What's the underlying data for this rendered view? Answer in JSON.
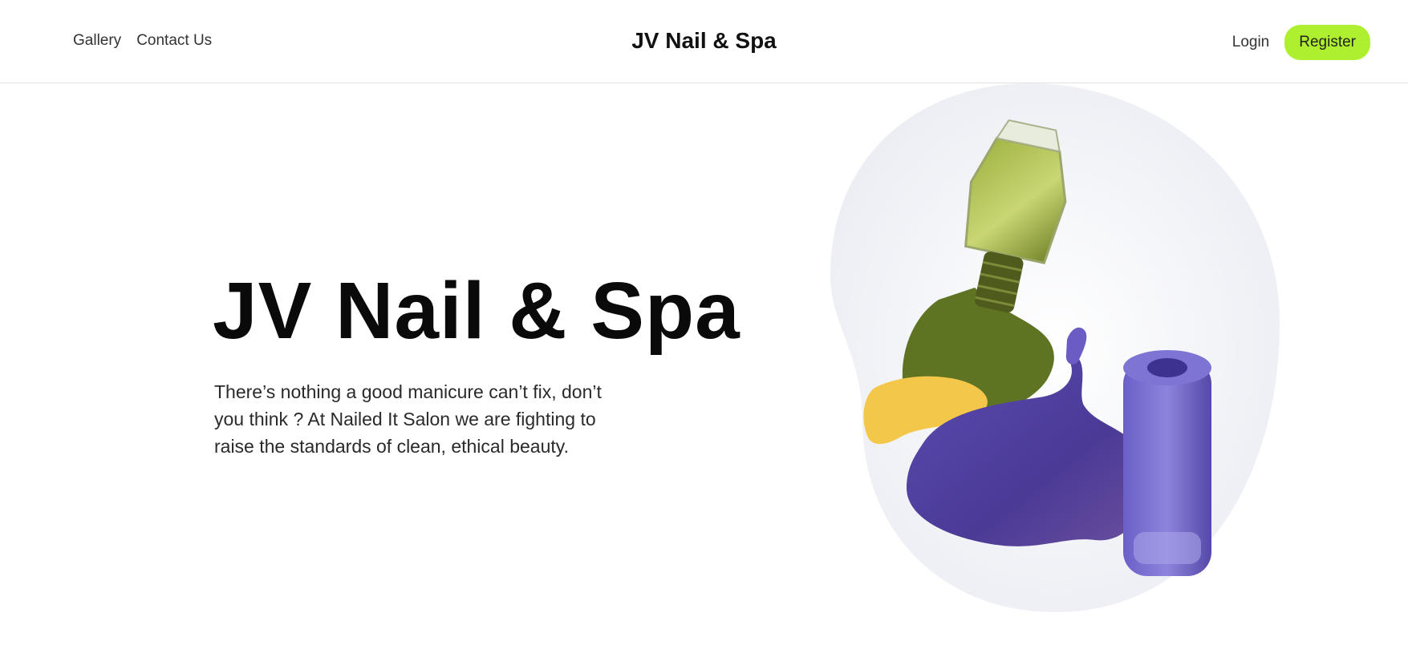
{
  "header": {
    "nav": [
      {
        "label": "Gallery"
      },
      {
        "label": "Contact Us"
      }
    ],
    "brand": "JV Nail & Spa",
    "login_label": "Login",
    "register_label": "Register"
  },
  "hero": {
    "title": "JV Nail & Spa",
    "description": "There’s nothing a good manicure can’t fix, don’t you think ? At Nailed It Salon we are fighting to raise the standards of clean, ethical beauty.",
    "image_icon": "nail-polish-bottles-illustration"
  },
  "colors": {
    "accent": "#aef02f",
    "text": "#111111",
    "polish_green": "#6b7d2a",
    "polish_yellow": "#f2c84b",
    "polish_purple": "#5b4aa6"
  }
}
